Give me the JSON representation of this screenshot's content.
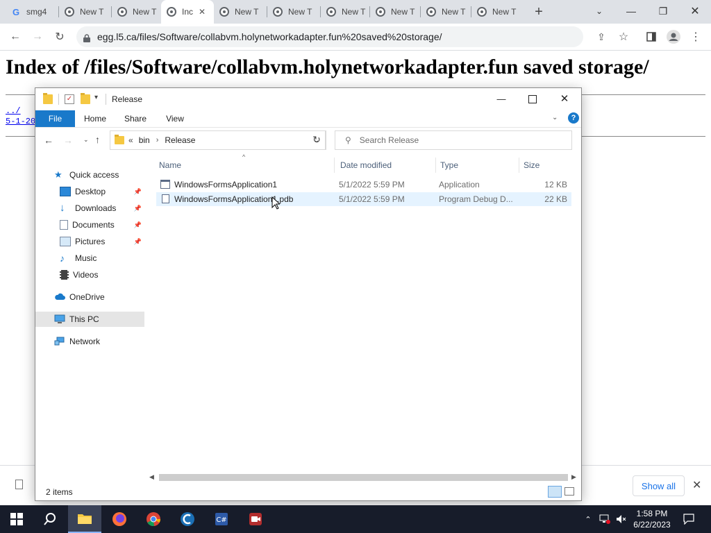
{
  "browser": {
    "tabs": [
      {
        "label": "smg4",
        "icon": "google-g-icon"
      },
      {
        "label": "New T",
        "icon": "chrome-icon"
      },
      {
        "label": "New T",
        "icon": "chrome-icon"
      },
      {
        "label": "Inc",
        "icon": "chrome-icon",
        "active": true
      },
      {
        "label": "New T",
        "icon": "chrome-icon"
      },
      {
        "label": "New T",
        "icon": "chrome-icon"
      },
      {
        "label": "New T",
        "icon": "chrome-icon"
      },
      {
        "label": "New T",
        "icon": "chrome-icon"
      },
      {
        "label": "New T",
        "icon": "chrome-icon"
      },
      {
        "label": "New T",
        "icon": "chrome-icon"
      }
    ],
    "url": "egg.l5.ca/files/Software/collabvm.holynetworkadapter.fun%20saved%20storage/"
  },
  "page": {
    "title": "Index of /files/Software/collabvm.holynetworkadapter.fun saved storage/",
    "links": [
      "../",
      "5-1-20"
    ]
  },
  "downloads": {
    "show_all": "Show all"
  },
  "explorer": {
    "title": "Release",
    "ribbon_tabs": [
      "File",
      "Home",
      "Share",
      "View"
    ],
    "breadcrumb": [
      "bin",
      "Release"
    ],
    "search_placeholder": "Search Release",
    "nav": [
      {
        "label": "Quick access",
        "icon": "star-icon"
      },
      {
        "label": "Desktop",
        "icon": "desktop-icon",
        "pinned": true
      },
      {
        "label": "Downloads",
        "icon": "download-icon",
        "pinned": true
      },
      {
        "label": "Documents",
        "icon": "documents-icon",
        "pinned": true
      },
      {
        "label": "Pictures",
        "icon": "pictures-icon",
        "pinned": true
      },
      {
        "label": "Music",
        "icon": "music-icon"
      },
      {
        "label": "Videos",
        "icon": "videos-icon"
      },
      {
        "label": "OneDrive",
        "icon": "cloud-icon"
      },
      {
        "label": "This PC",
        "icon": "computer-icon",
        "selected": true
      },
      {
        "label": "Network",
        "icon": "network-icon"
      }
    ],
    "columns": [
      "Name",
      "Date modified",
      "Type",
      "Size"
    ],
    "files": [
      {
        "name": "WindowsFormsApplication1",
        "date": "5/1/2022 5:59 PM",
        "type": "Application",
        "size": "12 KB"
      },
      {
        "name": "WindowsFormsApplication1.pdb",
        "date": "5/1/2022 5:59 PM",
        "type": "Program Debug D...",
        "size": "22 KB"
      }
    ],
    "status": "2 items"
  },
  "taskbar": {
    "time": "1:58 PM",
    "date": "6/22/2023",
    "apps": [
      "start-icon",
      "search-icon",
      "file-explorer-icon",
      "firefox-icon",
      "chrome-icon",
      "ccleaner-icon",
      "code-icon",
      "recorder-icon"
    ]
  },
  "colors": {
    "accent": "#1979ca",
    "taskbar": "#171c2a",
    "link": "#0000ee"
  }
}
